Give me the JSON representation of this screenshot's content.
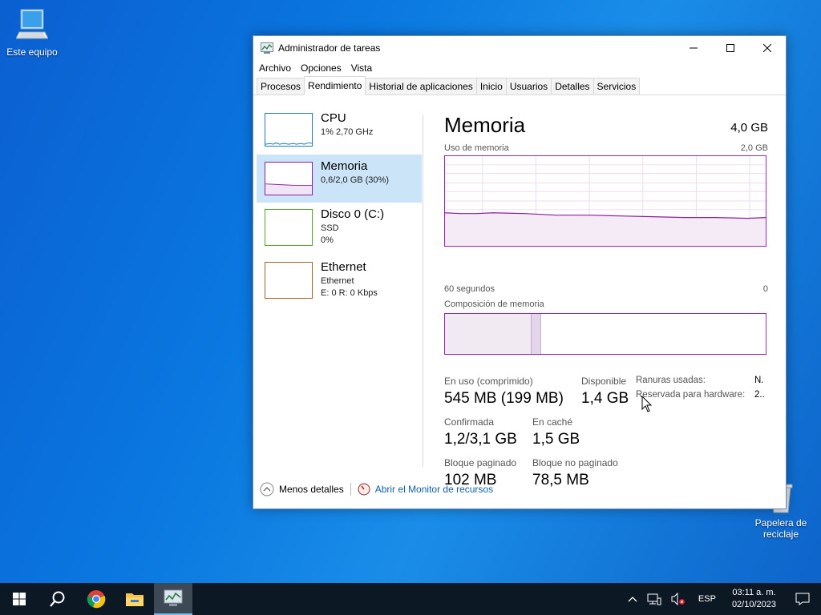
{
  "desktop": {
    "icons": [
      {
        "label": "Este equipo",
        "icon": "computer-icon"
      },
      {
        "label": "Papelera de reciclaje",
        "icon": "recycle-bin-icon"
      }
    ]
  },
  "window": {
    "title": "Administrador de tareas",
    "controls": {
      "minimize": "—",
      "maximize": "☐",
      "close": "✕"
    },
    "menu": [
      "Archivo",
      "Opciones",
      "Vista"
    ],
    "tabs": [
      {
        "label": "Procesos",
        "active": false
      },
      {
        "label": "Rendimiento",
        "active": true
      },
      {
        "label": "Historial de aplicaciones",
        "active": false
      },
      {
        "label": "Inicio",
        "active": false
      },
      {
        "label": "Usuarios",
        "active": false
      },
      {
        "label": "Detalles",
        "active": false
      },
      {
        "label": "Servicios",
        "active": false
      }
    ],
    "perf_items": [
      {
        "title": "CPU",
        "sub1": "1% 2,70 GHz",
        "sub2": "",
        "sub3": "",
        "color": "#1b7bc4",
        "selected": false
      },
      {
        "title": "Memoria",
        "sub1": "0,6/2,0 GB (30%)",
        "sub2": "",
        "sub3": "",
        "color": "#8b1e9f",
        "selected": true
      },
      {
        "title": "Disco 0 (C:)",
        "sub1": "SSD",
        "sub2": "0%",
        "sub3": "",
        "color": "#4da320",
        "selected": false
      },
      {
        "title": "Ethernet",
        "sub1": "Ethernet",
        "sub2": "E: 0 R: 0 Kbps",
        "sub3": "",
        "color": "#a7611a",
        "selected": false
      }
    ],
    "memory": {
      "title": "Memoria",
      "total": "4,0 GB",
      "usage_label": "Uso de memoria",
      "usage_max": "2,0 GB",
      "time_left": "60 segundos",
      "time_right": "0",
      "composition_label": "Composición de memoria",
      "composition": {
        "in_use_fraction": 0.27,
        "modified_fraction": 0.03
      },
      "usage_fraction": 0.3,
      "stats": {
        "in_use_label": "En uso (comprimido)",
        "in_use_value": "545 MB (199 MB)",
        "available_label": "Disponible",
        "available_value": "1,4 GB",
        "committed_label": "Confirmada",
        "committed_value": "1,2/3,1 GB",
        "cached_label": "En caché",
        "cached_value": "1,5 GB",
        "paged_label": "Bloque paginado",
        "paged_value": "102 MB",
        "nonpaged_label": "Bloque no paginado",
        "nonpaged_value": "78,5 MB",
        "slots_label": "Ranuras usadas:",
        "slots_value": "N.",
        "reserved_label": "Reservada para hardware:",
        "reserved_value": "2.."
      }
    },
    "footer": {
      "less_details": "Menos detalles",
      "resource_monitor": "Abrir el Monitor de recursos"
    }
  },
  "taskbar": {
    "items": [
      "windows-start-icon",
      "search-icon",
      "chrome-icon",
      "file-explorer-icon",
      "task-manager-icon"
    ],
    "language": "ESP",
    "time": "03:11 a. m.",
    "date": "02/10/2023"
  },
  "colors": {
    "accent": "#0078d7",
    "memory": "#8b1e9f",
    "selection": "#cce4f7"
  }
}
